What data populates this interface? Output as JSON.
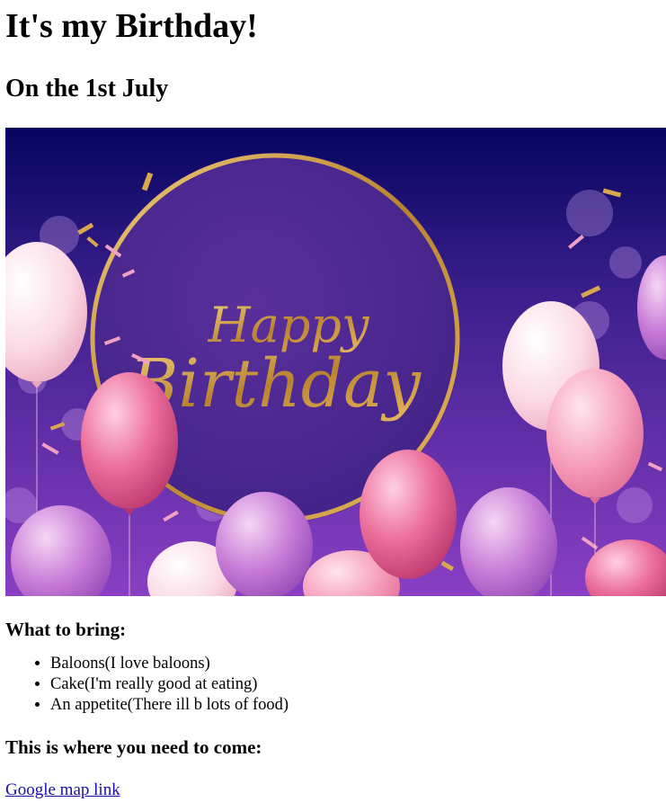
{
  "page": {
    "title": "It's my Birthday!",
    "subtitle": "On the 1st July"
  },
  "hero": {
    "text_happy": "Happy",
    "text_birthday": "Birthday"
  },
  "bring": {
    "heading": "What to bring:",
    "items": [
      "Baloons(I love baloons)",
      "Cake(I'm really good at eating)",
      "An appetite(There ill b lots of food)"
    ]
  },
  "location": {
    "heading": "This is where you need to come:",
    "link_text": "Google map link"
  },
  "colors": {
    "link": "#1a0dab",
    "hero_bg_top": "#05055e",
    "hero_bg_bottom": "#8a3fc4",
    "gold": "#c8933a"
  }
}
